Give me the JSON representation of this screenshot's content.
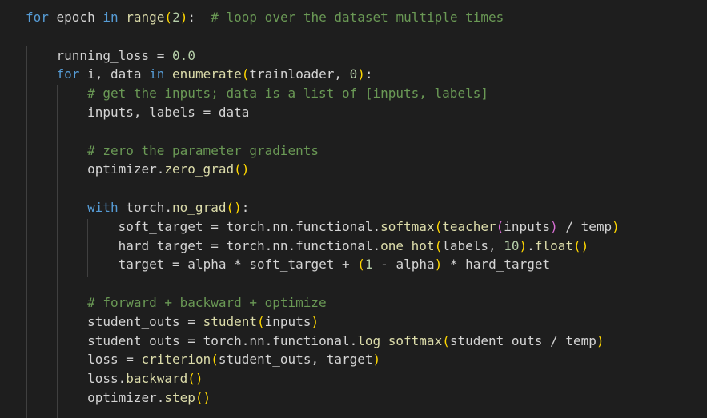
{
  "editor": {
    "theme_colors": {
      "background": "#1e1e1e",
      "keyword": "#569cd6",
      "function": "#dcdcaa",
      "variable": "#d4d4d4",
      "number": "#b5cea8",
      "comment": "#6a9955",
      "bracket1": "#ffd700",
      "bracket2": "#da70d6",
      "bracket3": "#179fff"
    },
    "lines": [
      {
        "tokens": [
          {
            "t": "for",
            "c": "kw"
          },
          {
            "t": " epoch ",
            "c": "var"
          },
          {
            "t": "in",
            "c": "kw"
          },
          {
            "t": " ",
            "c": "var"
          },
          {
            "t": "range",
            "c": "fn"
          },
          {
            "t": "(",
            "c": "p1"
          },
          {
            "t": "2",
            "c": "num"
          },
          {
            "t": ")",
            "c": "p1"
          },
          {
            "t": ":  ",
            "c": "op"
          },
          {
            "t": "# loop over the dataset multiple times",
            "c": "cm"
          }
        ]
      },
      {
        "tokens": []
      },
      {
        "tokens": [
          {
            "t": "    running_loss ",
            "c": "var"
          },
          {
            "t": "=",
            "c": "op"
          },
          {
            "t": " ",
            "c": "var"
          },
          {
            "t": "0.0",
            "c": "num"
          }
        ]
      },
      {
        "tokens": [
          {
            "t": "    ",
            "c": "var"
          },
          {
            "t": "for",
            "c": "kw"
          },
          {
            "t": " i, data ",
            "c": "var"
          },
          {
            "t": "in",
            "c": "kw"
          },
          {
            "t": " ",
            "c": "var"
          },
          {
            "t": "enumerate",
            "c": "fn"
          },
          {
            "t": "(",
            "c": "p1"
          },
          {
            "t": "trainloader, ",
            "c": "var"
          },
          {
            "t": "0",
            "c": "num"
          },
          {
            "t": ")",
            "c": "p1"
          },
          {
            "t": ":",
            "c": "op"
          }
        ]
      },
      {
        "tokens": [
          {
            "t": "        ",
            "c": "var"
          },
          {
            "t": "# get the inputs; data is a list of [inputs, labels]",
            "c": "cm"
          }
        ]
      },
      {
        "tokens": [
          {
            "t": "        inputs, labels ",
            "c": "var"
          },
          {
            "t": "=",
            "c": "op"
          },
          {
            "t": " data",
            "c": "var"
          }
        ]
      },
      {
        "tokens": []
      },
      {
        "tokens": [
          {
            "t": "        ",
            "c": "var"
          },
          {
            "t": "# zero the parameter gradients",
            "c": "cm"
          }
        ]
      },
      {
        "tokens": [
          {
            "t": "        optimizer.",
            "c": "var"
          },
          {
            "t": "zero_grad",
            "c": "fn"
          },
          {
            "t": "()",
            "c": "p1"
          }
        ]
      },
      {
        "tokens": []
      },
      {
        "tokens": [
          {
            "t": "        ",
            "c": "var"
          },
          {
            "t": "with",
            "c": "kw"
          },
          {
            "t": " torch.",
            "c": "var"
          },
          {
            "t": "no_grad",
            "c": "fn"
          },
          {
            "t": "()",
            "c": "p1"
          },
          {
            "t": ":",
            "c": "op"
          }
        ]
      },
      {
        "tokens": [
          {
            "t": "            soft_target ",
            "c": "var"
          },
          {
            "t": "=",
            "c": "op"
          },
          {
            "t": " torch.nn.functional.",
            "c": "var"
          },
          {
            "t": "softmax",
            "c": "fn"
          },
          {
            "t": "(",
            "c": "p1"
          },
          {
            "t": "teacher",
            "c": "fn"
          },
          {
            "t": "(",
            "c": "p2"
          },
          {
            "t": "inputs",
            "c": "var"
          },
          {
            "t": ")",
            "c": "p2"
          },
          {
            "t": " / temp",
            "c": "var"
          },
          {
            "t": ")",
            "c": "p1"
          }
        ]
      },
      {
        "tokens": [
          {
            "t": "            hard_target ",
            "c": "var"
          },
          {
            "t": "=",
            "c": "op"
          },
          {
            "t": " torch.nn.functional.",
            "c": "var"
          },
          {
            "t": "one_hot",
            "c": "fn"
          },
          {
            "t": "(",
            "c": "p1"
          },
          {
            "t": "labels, ",
            "c": "var"
          },
          {
            "t": "10",
            "c": "num"
          },
          {
            "t": ")",
            "c": "p1"
          },
          {
            "t": ".",
            "c": "var"
          },
          {
            "t": "float",
            "c": "fn"
          },
          {
            "t": "()",
            "c": "p1"
          }
        ]
      },
      {
        "tokens": [
          {
            "t": "            target ",
            "c": "var"
          },
          {
            "t": "=",
            "c": "op"
          },
          {
            "t": " alpha ",
            "c": "var"
          },
          {
            "t": "*",
            "c": "op"
          },
          {
            "t": " soft_target ",
            "c": "var"
          },
          {
            "t": "+",
            "c": "op"
          },
          {
            "t": " ",
            "c": "var"
          },
          {
            "t": "(",
            "c": "p1"
          },
          {
            "t": "1",
            "c": "num"
          },
          {
            "t": " - alpha",
            "c": "var"
          },
          {
            "t": ")",
            "c": "p1"
          },
          {
            "t": " ",
            "c": "var"
          },
          {
            "t": "*",
            "c": "op"
          },
          {
            "t": " hard_target",
            "c": "var"
          }
        ]
      },
      {
        "tokens": []
      },
      {
        "tokens": [
          {
            "t": "        ",
            "c": "var"
          },
          {
            "t": "# forward + backward + optimize",
            "c": "cm"
          }
        ]
      },
      {
        "tokens": [
          {
            "t": "        student_outs ",
            "c": "var"
          },
          {
            "t": "=",
            "c": "op"
          },
          {
            "t": " ",
            "c": "var"
          },
          {
            "t": "student",
            "c": "fn"
          },
          {
            "t": "(",
            "c": "p1"
          },
          {
            "t": "inputs",
            "c": "var"
          },
          {
            "t": ")",
            "c": "p1"
          }
        ]
      },
      {
        "tokens": [
          {
            "t": "        student_outs ",
            "c": "var"
          },
          {
            "t": "=",
            "c": "op"
          },
          {
            "t": " torch.nn.functional.",
            "c": "var"
          },
          {
            "t": "log_softmax",
            "c": "fn"
          },
          {
            "t": "(",
            "c": "p1"
          },
          {
            "t": "student_outs / temp",
            "c": "var"
          },
          {
            "t": ")",
            "c": "p1"
          }
        ]
      },
      {
        "tokens": [
          {
            "t": "        loss ",
            "c": "var"
          },
          {
            "t": "=",
            "c": "op"
          },
          {
            "t": " ",
            "c": "var"
          },
          {
            "t": "criterion",
            "c": "fn"
          },
          {
            "t": "(",
            "c": "p1"
          },
          {
            "t": "student_outs, target",
            "c": "var"
          },
          {
            "t": ")",
            "c": "p1"
          }
        ]
      },
      {
        "tokens": [
          {
            "t": "        loss.",
            "c": "var"
          },
          {
            "t": "backward",
            "c": "fn"
          },
          {
            "t": "()",
            "c": "p1"
          }
        ]
      },
      {
        "tokens": [
          {
            "t": "        optimizer.",
            "c": "var"
          },
          {
            "t": "step",
            "c": "fn"
          },
          {
            "t": "()",
            "c": "p1"
          }
        ]
      }
    ]
  }
}
